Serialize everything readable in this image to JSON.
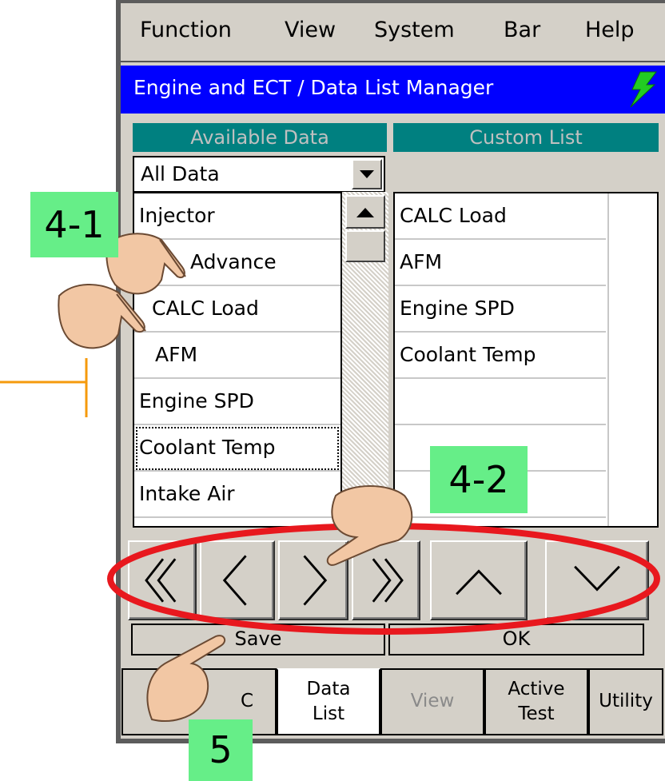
{
  "menu": {
    "items": [
      "Function",
      "View",
      "System",
      "Bar",
      "Help"
    ]
  },
  "title_bar": {
    "text": "Engine and ECT / Data List Manager",
    "icon": "lightning-bolt-icon"
  },
  "available_data": {
    "header": "Available Data",
    "filter_value": "All Data",
    "items": [
      "Injector",
      "Advance",
      "CALC Load",
      "AFM",
      "Engine SPD",
      "Coolant Temp",
      "Intake Air"
    ]
  },
  "custom_list": {
    "header": "Custom List",
    "items": [
      "CALC Load",
      "AFM",
      "Engine SPD",
      "Coolant Temp"
    ]
  },
  "arrow_buttons": [
    "move-all-left-icon",
    "move-left-icon",
    "move-right-icon",
    "move-all-right-icon",
    "move-up-icon",
    "move-down-icon"
  ],
  "actions": {
    "save": "Save",
    "ok": "OK"
  },
  "tabs": {
    "first": "C",
    "data_list": [
      "Data",
      "List"
    ],
    "view": "View",
    "active_test": [
      "Active",
      "Test"
    ],
    "utility": "Utility"
  },
  "annotations": {
    "step_4_1": "4-1",
    "step_4_2": "4-2",
    "step_5": "5"
  },
  "colors": {
    "title_bar": "#0000ff",
    "column_header": "#008080",
    "highlight_ellipse": "#e8181e",
    "step_label": "#66ee88",
    "pointer_line": "#f59a0c"
  }
}
